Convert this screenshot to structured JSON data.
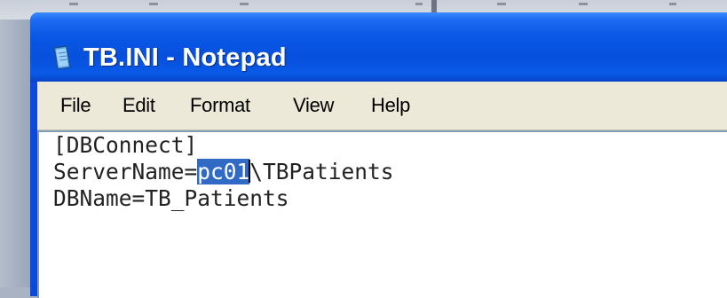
{
  "window": {
    "title": "TB.INI - Notepad",
    "title_color": "#ffffff",
    "titlebar_color": "#0a57e6"
  },
  "menu": {
    "file": "File",
    "edit": "Edit",
    "format": "Format",
    "view": "View",
    "help": "Help"
  },
  "document": {
    "line1": "[DBConnect]",
    "line2_prefix": "ServerName=",
    "line2_selected": "pc01",
    "line2_suffix": "\\TBPatients",
    "line3": "DBName=TB_Patients",
    "selection_color": "#316ac5"
  },
  "icons": {
    "app": "notepad-icon"
  }
}
